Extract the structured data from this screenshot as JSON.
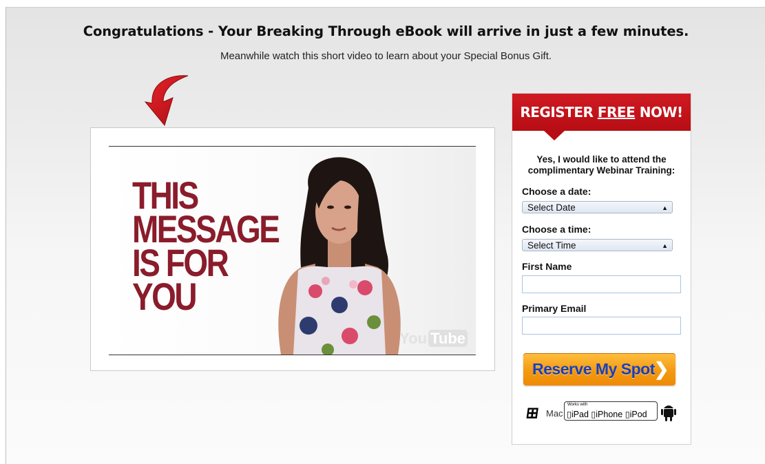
{
  "header": {
    "headline": "Congratulations - Your Breaking Through eBook will arrive in just a few minutes.",
    "subline": "Meanwhile watch this short video to learn about your Special Bonus Gift."
  },
  "video": {
    "message_lines": [
      "THIS",
      "MESSAGE",
      "IS FOR",
      "YOU"
    ],
    "logo_you": "You",
    "logo_tube": "Tube"
  },
  "form": {
    "banner_prefix": "REGISTER ",
    "banner_free": "FREE",
    "banner_suffix": " NOW!",
    "intro": "Yes, I would like to attend the complimentary Webinar Training:",
    "date_label": "Choose a date:",
    "date_value": "Select Date",
    "time_label": "Choose a time:",
    "time_value": "Select Time",
    "first_name_label": "First Name",
    "email_label": "Primary Email",
    "first_name_value": "",
    "email_value": "",
    "submit_label": "Reserve My Spot",
    "compat": {
      "mac_label": "Mac",
      "works_with": "Works with",
      "ipad": "iPad",
      "iphone": "iPhone",
      "ipod": "iPod"
    }
  },
  "colors": {
    "banner_red": "#c8141c",
    "message_maroon": "#8a1c2b",
    "button_orange": "#f39a12",
    "button_text_blue": "#1b3fb8"
  }
}
